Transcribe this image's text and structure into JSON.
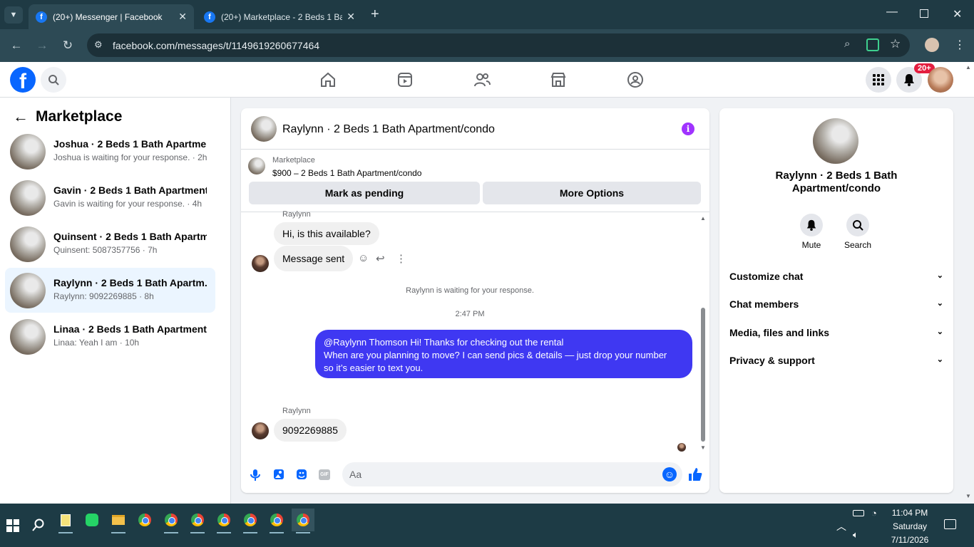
{
  "browser": {
    "tabs": [
      {
        "title": "(20+) Messenger | Facebook",
        "active": true
      },
      {
        "title": "(20+) Marketplace - 2 Beds 1 Ba",
        "active": false
      }
    ],
    "url": "facebook.com/messages/t/1149619260677464"
  },
  "fb_header": {
    "notification_badge": "20+",
    "nav_icons": [
      "home-icon",
      "video-icon",
      "friends-icon",
      "marketplace-icon",
      "groups-icon"
    ]
  },
  "left_panel": {
    "title": "Marketplace",
    "conversations": [
      {
        "name": "Joshua · 2 Beds 1 Bath Apartme...",
        "sub": "Joshua is waiting for your response. · 2h"
      },
      {
        "name": "Gavin · 2 Beds 1 Bath Apartment...",
        "sub": "Gavin is waiting for your response. · 4h"
      },
      {
        "name": "Quinsent · 2 Beds 1 Bath Apartm...",
        "sub": "Quinsent: 5087357756 · 7h"
      },
      {
        "name": "Raylynn · 2 Beds 1 Bath Apartm...",
        "sub": "Raylynn: 9092269885 · 8h"
      },
      {
        "name": "Linaa · 2 Beds 1 Bath Apartment...",
        "sub": "Linaa: Yeah I am · 10h"
      }
    ]
  },
  "chat": {
    "title": "Raylynn · 2 Beds 1 Bath Apartment/condo",
    "marketplace_label": "Marketplace",
    "listing": "$900 – 2 Beds 1 Bath Apartment/condo",
    "mark_pending": "Mark as pending",
    "more_options": "More Options",
    "sender_top": "Raylynn",
    "msg1": "Hi, is this available?",
    "msg2": "Message sent",
    "waiting": "Raylynn is waiting for your response.",
    "time": "2:47 PM",
    "sent_lines": [
      "@Raylynn Thomson Hi! Thanks for checking out the rental",
      "When are you planning to move? I can send pics & details — just drop your number",
      "so it’s easier to text you."
    ],
    "sender_bottom": "Raylynn",
    "msg3": "9092269885",
    "composer_placeholder": "Aa"
  },
  "right_panel": {
    "name": "Raylynn · 2 Beds 1 Bath Apartment/condo",
    "mute": "Mute",
    "search": "Search",
    "sections": [
      "Customize chat",
      "Chat members",
      "Media, files and links",
      "Privacy & support"
    ]
  },
  "taskbar": {
    "time": "11:04 PM",
    "day": "Saturday",
    "date": "7/11/2026"
  },
  "colors": {
    "fb_blue": "#0866ff",
    "sent_bubble": "#3f38f2",
    "info_purple": "#a033ff",
    "badge_red": "#e41e3f"
  }
}
